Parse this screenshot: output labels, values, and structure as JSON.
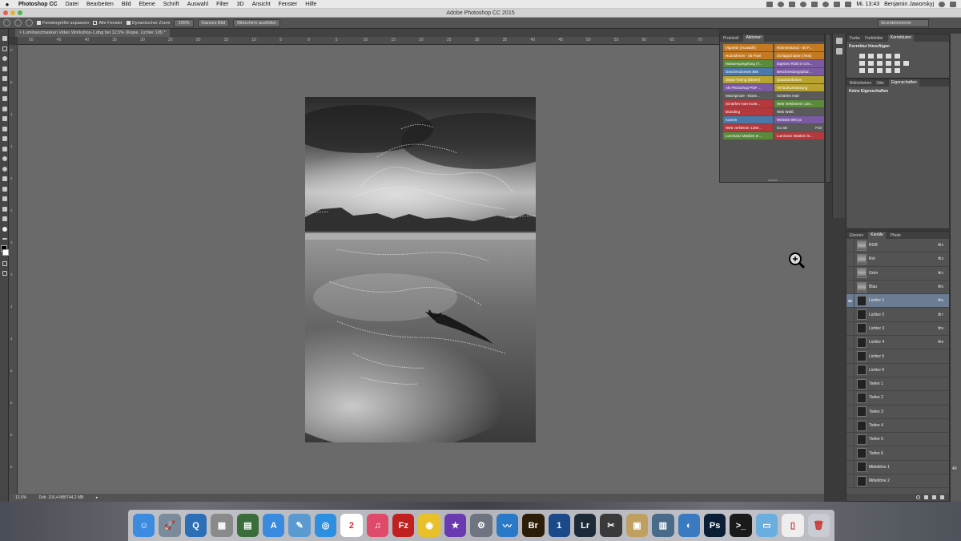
{
  "menubar": {
    "app": "Photoshop CC",
    "items": [
      "Datei",
      "Bearbeiten",
      "Bild",
      "Ebene",
      "Schrift",
      "Auswahl",
      "Filter",
      "3D",
      "Ansicht",
      "Fenster",
      "Hilfe"
    ],
    "clock": "Mi. 13:43",
    "user": "Benjamin Jaworskyj"
  },
  "titlebar": {
    "title": "Adobe Photoshop CC 2015"
  },
  "options": {
    "fit_window": "Fenstergröße anpassen",
    "all_windows": "Alle Fenster",
    "scrubby_zoom": "Dynamischer Zoom",
    "zoom_value": "100%",
    "fit_screen": "Ganzes Bild",
    "fill_screen": "Bildschirm ausfüllen",
    "workspace": "Grundelemente"
  },
  "document": {
    "tab": "Luminanzmasken Video Workshop-1.dng bei 12,5% (Kopie, Lichter 1/8) *",
    "status_zoom": "12,5%",
    "status_doc": "Dok: 103,4 MB/744,2 MB"
  },
  "ruler_top": [
    "50",
    "45",
    "40",
    "35",
    "30",
    "25",
    "20",
    "15",
    "10",
    "5",
    "0",
    "5",
    "10",
    "15",
    "20",
    "25",
    "30",
    "35",
    "40",
    "45",
    "50",
    "55",
    "60",
    "65",
    "70"
  ],
  "ruler_left": [
    "0",
    "5",
    "1",
    "1",
    "2",
    "2",
    "3",
    "3",
    "4",
    "4",
    "5",
    "5",
    "6",
    "6"
  ],
  "actions_panel": {
    "tabs": [
      "Protokoll",
      "Aktionen"
    ],
    "active_tab": "Aktionen",
    "items": [
      {
        "label": "Vignette (Auswahl)",
        "color": "#c47a23"
      },
      {
        "label": "Rahmenkanal - 50 P...",
        "color": "#c47a23"
      },
      {
        "label": "Holzrahmen - 50 Pixel",
        "color": "#c47a23"
      },
      {
        "label": "Schlagschatten (Text)",
        "color": "#c47a23"
      },
      {
        "label": "Wasserspiegelung (T...",
        "color": "#5a8a3a"
      },
      {
        "label": "Eigenes RGB in Grs...",
        "color": "#7a5aa3"
      },
      {
        "label": "Geschmolzenes Blei",
        "color": "#4a78a8"
      },
      {
        "label": "Beschneidungspfad ...",
        "color": "#7a5aa3"
      },
      {
        "label": "Sepia-Toning (Ebene)",
        "color": "#b8a330"
      },
      {
        "label": "Quadrantfarben",
        "color": "#b8a330"
      },
      {
        "label": "Als Photoshop-PDF ...",
        "color": "#7a5aa3"
      },
      {
        "label": "Verlaufsumsetzung",
        "color": "#b8a330"
      },
      {
        "label": "Mischpinsel - Klone...",
        "color": "#5a5a5a"
      },
      {
        "label": "Schärfen Hart",
        "color": "#5a5a5a"
      },
      {
        "label": "Schärfen Hart Kontr...",
        "color": "#b5383c"
      },
      {
        "label": "Web Verkleinern 120...",
        "color": "#5a8a3a"
      },
      {
        "label": "Branding",
        "color": "#b5383c"
      },
      {
        "label": "Web Weiß",
        "color": "#5a5a5a"
      },
      {
        "label": "Kurven",
        "color": "#4a78a8"
      },
      {
        "label": "Website 900 px",
        "color": "#7a5aa3"
      },
      {
        "label": "Web verkleiner 1200...",
        "color": "#b5383c"
      },
      {
        "label": "Go 3D",
        "color": "#5a5a5a"
      },
      {
        "label": "Luminanz Masken er...",
        "color": "#5a8a3a"
      },
      {
        "label": "Luminanz Masken lö...",
        "color": "#b5383c"
      }
    ],
    "go3d_key": "F10"
  },
  "adjustments_panel": {
    "tabs": [
      "Farbe",
      "Farbfelder",
      "Korrekturen"
    ],
    "active_tab": "Korrekturen",
    "heading": "Korrektur hinzufügen"
  },
  "properties_panel": {
    "tabs": [
      "Bibliotheken",
      "Stile",
      "Eigenschaften"
    ],
    "active_tab": "Eigenschaften",
    "message": "Keine Eigenschaften"
  },
  "channels_panel": {
    "tabs": [
      "Ebenen",
      "Kanäle",
      "Pfade"
    ],
    "active_tab": "Kanäle",
    "rows": [
      {
        "name": "RGB",
        "key": "⌘2",
        "selected": false,
        "eye": false
      },
      {
        "name": "Rot",
        "key": "⌘3",
        "selected": false,
        "eye": false
      },
      {
        "name": "Grün",
        "key": "⌘4",
        "selected": false,
        "eye": false
      },
      {
        "name": "Blau",
        "key": "⌘5",
        "selected": false,
        "eye": false
      },
      {
        "name": "Lichter 1",
        "key": "⌘6",
        "selected": true,
        "eye": true
      },
      {
        "name": "Lichter 2",
        "key": "⌘7",
        "selected": false,
        "eye": false
      },
      {
        "name": "Lichter 3",
        "key": "⌘8",
        "selected": false,
        "eye": false
      },
      {
        "name": "Lichter 4",
        "key": "⌘9",
        "selected": false,
        "eye": false
      },
      {
        "name": "Lichter 5",
        "key": "",
        "selected": false,
        "eye": false
      },
      {
        "name": "Lichter 6",
        "key": "",
        "selected": false,
        "eye": false
      },
      {
        "name": "Tiefen 1",
        "key": "",
        "selected": false,
        "eye": false
      },
      {
        "name": "Tiefen 2",
        "key": "",
        "selected": false,
        "eye": false
      },
      {
        "name": "Tiefen 3",
        "key": "",
        "selected": false,
        "eye": false
      },
      {
        "name": "Tiefen 4",
        "key": "",
        "selected": false,
        "eye": false
      },
      {
        "name": "Tiefen 5",
        "key": "",
        "selected": false,
        "eye": false
      },
      {
        "name": "Tiefen 6",
        "key": "",
        "selected": false,
        "eye": false
      },
      {
        "name": "Mitteltöne 1",
        "key": "",
        "selected": false,
        "eye": false
      },
      {
        "name": "Mitteltöne 2",
        "key": "",
        "selected": false,
        "eye": false
      }
    ]
  },
  "dock": {
    "apps": [
      {
        "name": "finder-icon",
        "color": "#3c8be0",
        "glyph": "☺"
      },
      {
        "name": "launchpad-icon",
        "color": "#7b8b9b",
        "glyph": "🚀"
      },
      {
        "name": "quicktime-icon",
        "color": "#2d6fb7",
        "glyph": "Q"
      },
      {
        "name": "calculator-icon",
        "color": "#8a8a8a",
        "glyph": "▦"
      },
      {
        "name": "mission-control-icon",
        "color": "#3a6d3a",
        "glyph": "▤"
      },
      {
        "name": "app-store-icon",
        "color": "#3a8be0",
        "glyph": "A"
      },
      {
        "name": "preview-icon",
        "color": "#5a9ad0",
        "glyph": "✎"
      },
      {
        "name": "safari-icon",
        "color": "#2d8fe0",
        "glyph": "◎"
      },
      {
        "name": "calendar-icon",
        "color": "#ffffff",
        "glyph": "2"
      },
      {
        "name": "itunes-icon",
        "color": "#e04a6a",
        "glyph": "♫"
      },
      {
        "name": "filezilla-icon",
        "color": "#c02020",
        "glyph": "Fz"
      },
      {
        "name": "chrome-icon",
        "color": "#e8c12a",
        "glyph": "◉"
      },
      {
        "name": "imovie-icon",
        "color": "#6a3ab0",
        "glyph": "★"
      },
      {
        "name": "system-preferences-icon",
        "color": "#6f7580",
        "glyph": "⚙"
      },
      {
        "name": "skitch-icon",
        "color": "#2a78c8",
        "glyph": "〰"
      },
      {
        "name": "bridge-icon",
        "color": "#2b1d08",
        "glyph": "Br"
      },
      {
        "name": "1password-icon",
        "color": "#1a4a8a",
        "glyph": "1"
      },
      {
        "name": "lightroom-icon",
        "color": "#1d2a38",
        "glyph": "Lr"
      },
      {
        "name": "final-cut-icon",
        "color": "#3a3a3a",
        "glyph": "✂"
      },
      {
        "name": "photo-app-icon",
        "color": "#c0a060",
        "glyph": "▣"
      },
      {
        "name": "image-capture-icon",
        "color": "#4a6a8a",
        "glyph": "▥"
      },
      {
        "name": "screen-sharing-icon",
        "color": "#3a7ac0",
        "glyph": "◐"
      },
      {
        "name": "photoshop-icon",
        "color": "#0a1f35",
        "glyph": "Ps"
      },
      {
        "name": "terminal-icon",
        "color": "#1a1a1a",
        "glyph": ">_"
      },
      {
        "name": "folder-icon",
        "color": "#6aaee0",
        "glyph": "▭"
      },
      {
        "name": "document-icon",
        "color": "#eeeeee",
        "glyph": "▯"
      },
      {
        "name": "trash-icon",
        "color": "#c9ccd2",
        "glyph": "🗑"
      }
    ],
    "calendar_badge": "2"
  },
  "side_number": "40"
}
